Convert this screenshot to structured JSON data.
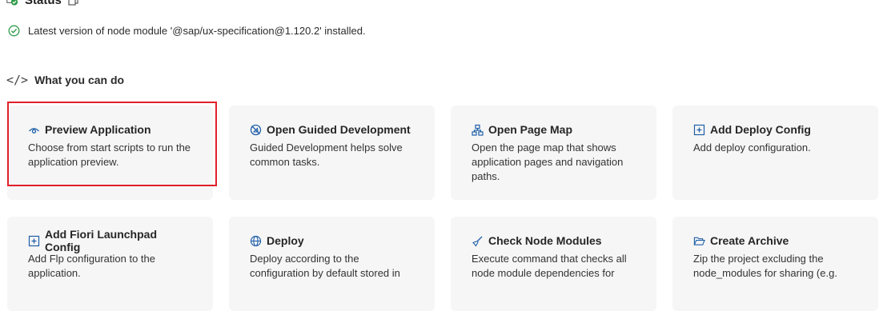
{
  "status": {
    "title": "Status",
    "message": "Latest version of node module '@sap/ux-specification@1.120.2' installed."
  },
  "section": {
    "title": "What you can do"
  },
  "cards": [
    {
      "title": "Preview Application",
      "desc": "Choose from start scripts to run the application preview.",
      "icon": "eye-icon"
    },
    {
      "title": "Open Guided Development",
      "desc": "Guided Development helps solve common tasks.",
      "icon": "guided-icon"
    },
    {
      "title": "Open Page Map",
      "desc": "Open the page map that shows application pages and navigation paths.",
      "icon": "sitemap-icon"
    },
    {
      "title": "Add Deploy Config",
      "desc": "Add deploy configuration.",
      "icon": "add-box-icon"
    },
    {
      "title": "Add Fiori Launchpad Config",
      "desc": "Add Flp configuration to the application.",
      "icon": "add-box-icon"
    },
    {
      "title": "Deploy",
      "desc": "Deploy according to the configuration by default stored in",
      "icon": "globe-icon"
    },
    {
      "title": "Check Node Modules",
      "desc": "Execute command that checks all node module dependencies for",
      "icon": "broom-icon"
    },
    {
      "title": "Create Archive",
      "desc": "Zip the project excluding the node_modules for sharing (e.g.",
      "icon": "folder-open-icon"
    }
  ],
  "colors": {
    "accent": "#1f5fa8",
    "success": "#2e9b48",
    "highlight": "#e0202a",
    "card_bg": "#f6f6f6"
  }
}
